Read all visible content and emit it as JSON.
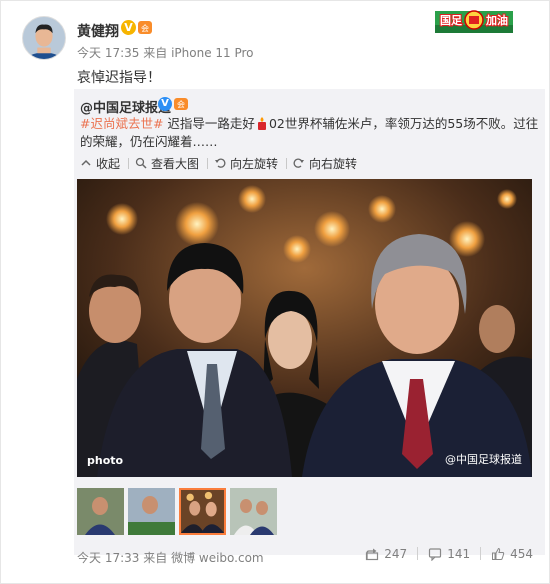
{
  "post": {
    "author": "黄健翔",
    "verified_icon": "yellow-v-icon",
    "time": "今天 17:35",
    "source_prefix": "来自",
    "source": "iPhone 11 Pro",
    "text": "哀悼迟指导！",
    "badge_icon": "guocheng-jiayou-badge"
  },
  "repost": {
    "author": "@中国足球报道",
    "verified_icon": "blue-v-icon",
    "hashtag": "#迟尚斌去世#",
    "text_part1": " 迟指导一路走好",
    "text_part2": "02世界杯辅佐米卢，率领万达的55场不败。过往的荣耀，仍在闪耀着……",
    "toolbar": {
      "collapse": "收起",
      "view_large": "查看大图",
      "rotate_left": "向左旋转",
      "rotate_right": "向右旋转"
    },
    "photo": {
      "watermark_left": "photo",
      "watermark_right": "@中国足球报道"
    },
    "thumbnails": 4,
    "active_thumbnail": 3,
    "time": "今天 17:33",
    "source_prefix": "来自",
    "source": "微博 weibo.com",
    "shares": "247",
    "comments": "141",
    "likes": "454"
  },
  "colors": {
    "link_orange": "#eb7350",
    "gray_text": "#808080",
    "repost_bg": "#f2f2f5",
    "verified_yellow": "#f7b500",
    "verified_blue": "#2d8ff5"
  }
}
